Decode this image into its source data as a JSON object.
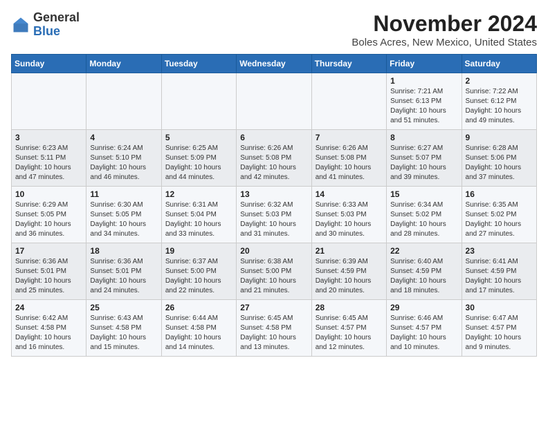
{
  "header": {
    "logo_general": "General",
    "logo_blue": "Blue",
    "month_title": "November 2024",
    "location": "Boles Acres, New Mexico, United States"
  },
  "weekdays": [
    "Sunday",
    "Monday",
    "Tuesday",
    "Wednesday",
    "Thursday",
    "Friday",
    "Saturday"
  ],
  "weeks": [
    [
      {
        "day": "",
        "sunrise": "",
        "sunset": "",
        "daylight": ""
      },
      {
        "day": "",
        "sunrise": "",
        "sunset": "",
        "daylight": ""
      },
      {
        "day": "",
        "sunrise": "",
        "sunset": "",
        "daylight": ""
      },
      {
        "day": "",
        "sunrise": "",
        "sunset": "",
        "daylight": ""
      },
      {
        "day": "",
        "sunrise": "",
        "sunset": "",
        "daylight": ""
      },
      {
        "day": "1",
        "sunrise": "Sunrise: 7:21 AM",
        "sunset": "Sunset: 6:13 PM",
        "daylight": "Daylight: 10 hours and 51 minutes."
      },
      {
        "day": "2",
        "sunrise": "Sunrise: 7:22 AM",
        "sunset": "Sunset: 6:12 PM",
        "daylight": "Daylight: 10 hours and 49 minutes."
      }
    ],
    [
      {
        "day": "3",
        "sunrise": "Sunrise: 6:23 AM",
        "sunset": "Sunset: 5:11 PM",
        "daylight": "Daylight: 10 hours and 47 minutes."
      },
      {
        "day": "4",
        "sunrise": "Sunrise: 6:24 AM",
        "sunset": "Sunset: 5:10 PM",
        "daylight": "Daylight: 10 hours and 46 minutes."
      },
      {
        "day": "5",
        "sunrise": "Sunrise: 6:25 AM",
        "sunset": "Sunset: 5:09 PM",
        "daylight": "Daylight: 10 hours and 44 minutes."
      },
      {
        "day": "6",
        "sunrise": "Sunrise: 6:26 AM",
        "sunset": "Sunset: 5:08 PM",
        "daylight": "Daylight: 10 hours and 42 minutes."
      },
      {
        "day": "7",
        "sunrise": "Sunrise: 6:26 AM",
        "sunset": "Sunset: 5:08 PM",
        "daylight": "Daylight: 10 hours and 41 minutes."
      },
      {
        "day": "8",
        "sunrise": "Sunrise: 6:27 AM",
        "sunset": "Sunset: 5:07 PM",
        "daylight": "Daylight: 10 hours and 39 minutes."
      },
      {
        "day": "9",
        "sunrise": "Sunrise: 6:28 AM",
        "sunset": "Sunset: 5:06 PM",
        "daylight": "Daylight: 10 hours and 37 minutes."
      }
    ],
    [
      {
        "day": "10",
        "sunrise": "Sunrise: 6:29 AM",
        "sunset": "Sunset: 5:05 PM",
        "daylight": "Daylight: 10 hours and 36 minutes."
      },
      {
        "day": "11",
        "sunrise": "Sunrise: 6:30 AM",
        "sunset": "Sunset: 5:05 PM",
        "daylight": "Daylight: 10 hours and 34 minutes."
      },
      {
        "day": "12",
        "sunrise": "Sunrise: 6:31 AM",
        "sunset": "Sunset: 5:04 PM",
        "daylight": "Daylight: 10 hours and 33 minutes."
      },
      {
        "day": "13",
        "sunrise": "Sunrise: 6:32 AM",
        "sunset": "Sunset: 5:03 PM",
        "daylight": "Daylight: 10 hours and 31 minutes."
      },
      {
        "day": "14",
        "sunrise": "Sunrise: 6:33 AM",
        "sunset": "Sunset: 5:03 PM",
        "daylight": "Daylight: 10 hours and 30 minutes."
      },
      {
        "day": "15",
        "sunrise": "Sunrise: 6:34 AM",
        "sunset": "Sunset: 5:02 PM",
        "daylight": "Daylight: 10 hours and 28 minutes."
      },
      {
        "day": "16",
        "sunrise": "Sunrise: 6:35 AM",
        "sunset": "Sunset: 5:02 PM",
        "daylight": "Daylight: 10 hours and 27 minutes."
      }
    ],
    [
      {
        "day": "17",
        "sunrise": "Sunrise: 6:36 AM",
        "sunset": "Sunset: 5:01 PM",
        "daylight": "Daylight: 10 hours and 25 minutes."
      },
      {
        "day": "18",
        "sunrise": "Sunrise: 6:36 AM",
        "sunset": "Sunset: 5:01 PM",
        "daylight": "Daylight: 10 hours and 24 minutes."
      },
      {
        "day": "19",
        "sunrise": "Sunrise: 6:37 AM",
        "sunset": "Sunset: 5:00 PM",
        "daylight": "Daylight: 10 hours and 22 minutes."
      },
      {
        "day": "20",
        "sunrise": "Sunrise: 6:38 AM",
        "sunset": "Sunset: 5:00 PM",
        "daylight": "Daylight: 10 hours and 21 minutes."
      },
      {
        "day": "21",
        "sunrise": "Sunrise: 6:39 AM",
        "sunset": "Sunset: 4:59 PM",
        "daylight": "Daylight: 10 hours and 20 minutes."
      },
      {
        "day": "22",
        "sunrise": "Sunrise: 6:40 AM",
        "sunset": "Sunset: 4:59 PM",
        "daylight": "Daylight: 10 hours and 18 minutes."
      },
      {
        "day": "23",
        "sunrise": "Sunrise: 6:41 AM",
        "sunset": "Sunset: 4:59 PM",
        "daylight": "Daylight: 10 hours and 17 minutes."
      }
    ],
    [
      {
        "day": "24",
        "sunrise": "Sunrise: 6:42 AM",
        "sunset": "Sunset: 4:58 PM",
        "daylight": "Daylight: 10 hours and 16 minutes."
      },
      {
        "day": "25",
        "sunrise": "Sunrise: 6:43 AM",
        "sunset": "Sunset: 4:58 PM",
        "daylight": "Daylight: 10 hours and 15 minutes."
      },
      {
        "day": "26",
        "sunrise": "Sunrise: 6:44 AM",
        "sunset": "Sunset: 4:58 PM",
        "daylight": "Daylight: 10 hours and 14 minutes."
      },
      {
        "day": "27",
        "sunrise": "Sunrise: 6:45 AM",
        "sunset": "Sunset: 4:58 PM",
        "daylight": "Daylight: 10 hours and 13 minutes."
      },
      {
        "day": "28",
        "sunrise": "Sunrise: 6:45 AM",
        "sunset": "Sunset: 4:57 PM",
        "daylight": "Daylight: 10 hours and 12 minutes."
      },
      {
        "day": "29",
        "sunrise": "Sunrise: 6:46 AM",
        "sunset": "Sunset: 4:57 PM",
        "daylight": "Daylight: 10 hours and 10 minutes."
      },
      {
        "day": "30",
        "sunrise": "Sunrise: 6:47 AM",
        "sunset": "Sunset: 4:57 PM",
        "daylight": "Daylight: 10 hours and 9 minutes."
      }
    ]
  ]
}
